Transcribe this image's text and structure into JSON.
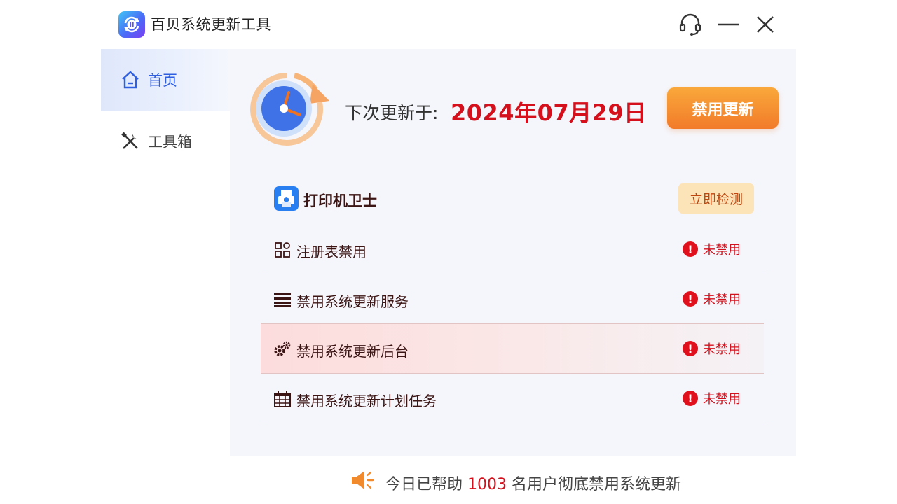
{
  "app": {
    "title": "百贝系统更新工具"
  },
  "titlebar": {
    "icons": [
      "headset-icon",
      "minimize-icon",
      "close-icon"
    ]
  },
  "sidebar": {
    "items": [
      {
        "label": "首页",
        "icon": "home-icon",
        "active": true
      },
      {
        "label": "工具箱",
        "icon": "tools-icon",
        "active": false
      }
    ]
  },
  "main": {
    "next_update_label": "下次更新于:",
    "next_update_date": "2024年07月29日",
    "disable_button": "禁用更新",
    "printer": {
      "label": "打印机卫士",
      "button": "立即检测"
    },
    "items": [
      {
        "label": "注册表禁用",
        "icon": "grid-icon",
        "status": "未禁用"
      },
      {
        "label": "禁用系统更新服务",
        "icon": "list-icon",
        "status": "未禁用"
      },
      {
        "label": "禁用系统更新后台",
        "icon": "gears-icon",
        "status": "未禁用"
      },
      {
        "label": "禁用系统更新计划任务",
        "icon": "calendar-icon",
        "status": "未禁用"
      }
    ]
  },
  "footer": {
    "prefix": "今日已帮助",
    "count": "1003",
    "suffix": "名用户彻底禁用系统更新"
  },
  "colors": {
    "accent_blue": "#2f5ee0",
    "alert_red": "#d4101c",
    "button_orange": "#f27b2a",
    "panel_bg": "#f5f6fb"
  }
}
